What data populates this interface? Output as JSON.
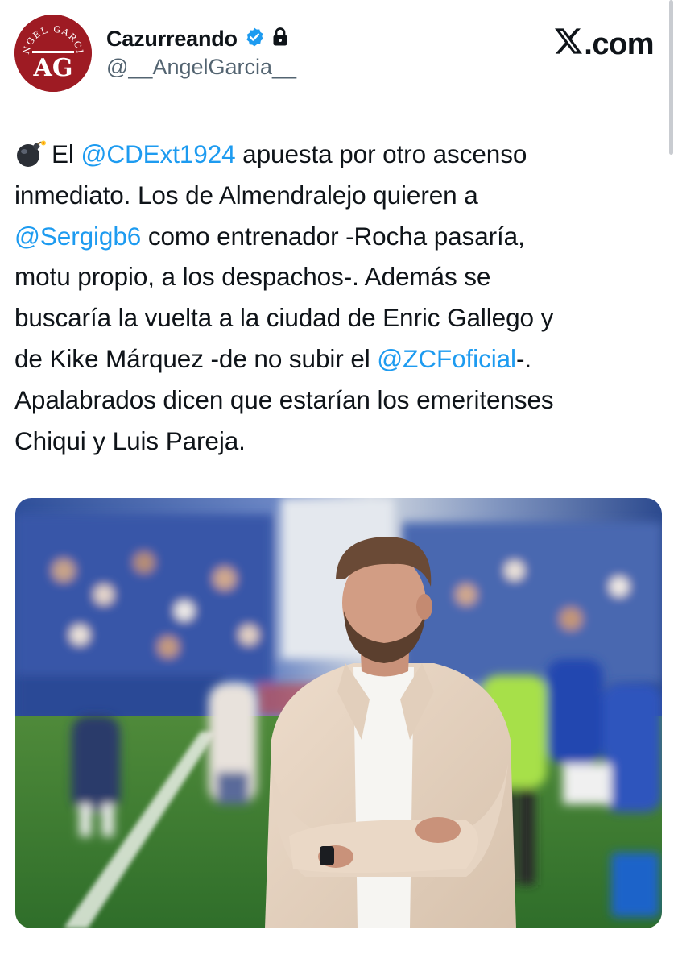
{
  "author": {
    "display_name": "Cazurreando",
    "handle": "@__AngelGarcia__",
    "avatar_text": "ANGEL GARCIA",
    "avatar_monogram": "AG",
    "verified_icon": "verified-badge-icon",
    "protected_icon": "lock-icon"
  },
  "brand": {
    "logo_text": ".com",
    "logo_icon": "x-logo-icon"
  },
  "tweet": {
    "emoji_icon": "bomb-icon",
    "lines": [
      [
        {
          "t": "El "
        },
        {
          "t": "@CDExt1924",
          "m": true
        },
        {
          "t": " apuesta por otro ascenso"
        }
      ],
      [
        {
          "t": "inmediato. Los de Almendralejo quieren a"
        }
      ],
      [
        {
          "t": "@Sergigb6",
          "m": true
        },
        {
          "t": " como entrenador -Rocha pasaría,"
        }
      ],
      [
        {
          "t": "motu propio, a los despachos-. Además se"
        }
      ],
      [
        {
          "t": "buscaría la vuelta a la ciudad de Enric Gallego y"
        }
      ],
      [
        {
          "t": "de Kike Márquez -de no subir el "
        },
        {
          "t": "@ZCFoficial",
          "m": true
        },
        {
          "t": "-."
        }
      ],
      [
        {
          "t": "Apalabrados dicen que estarían los emeritenses"
        }
      ],
      [
        {
          "t": "Chiqui y Luis Pareja."
        }
      ]
    ]
  },
  "colors": {
    "mention": "#1d9bf0",
    "verified": "#1d9bf0",
    "avatar_bg": "#9e1b23",
    "text": "#0f1419",
    "secondary_text": "#536471"
  }
}
